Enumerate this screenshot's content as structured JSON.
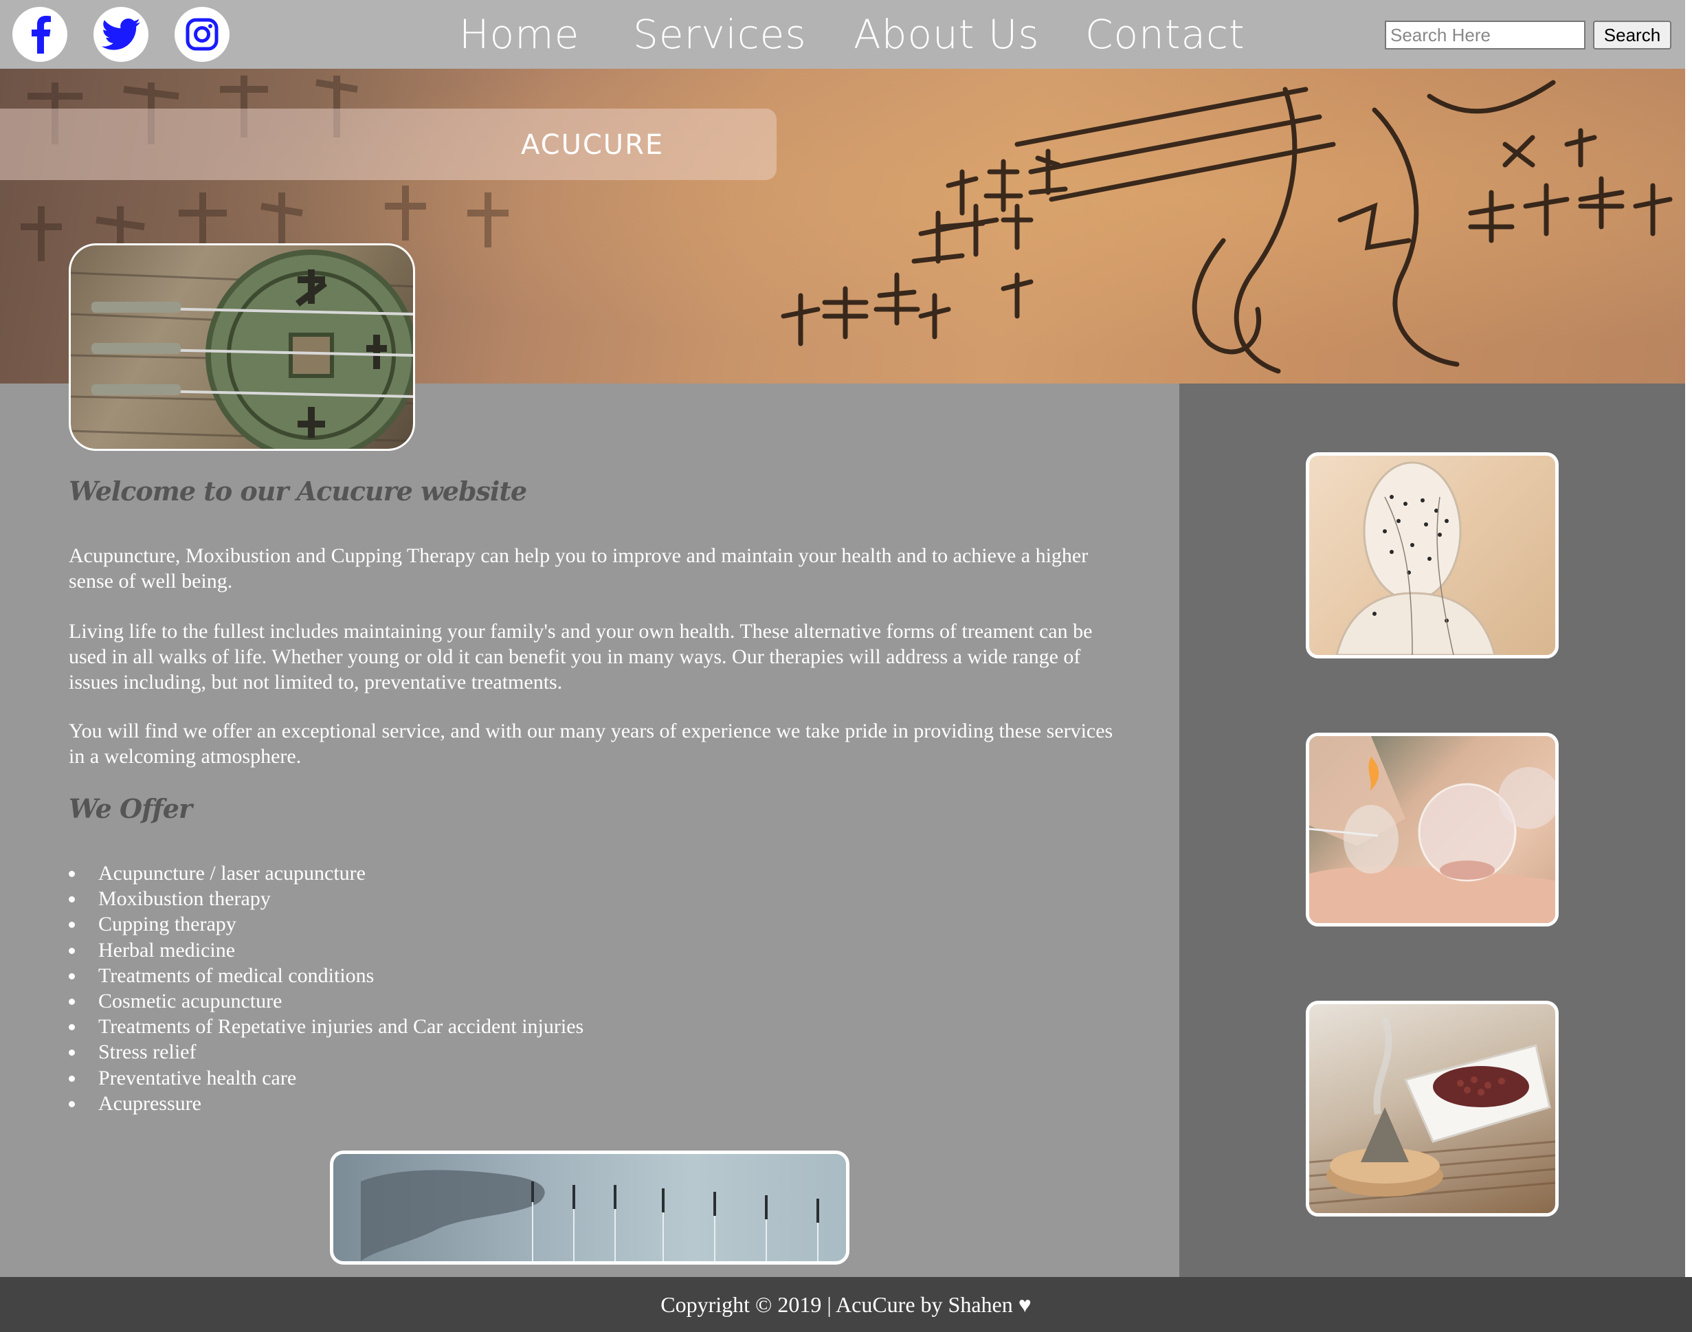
{
  "social": {
    "facebook_icon": "facebook-icon",
    "twitter_icon": "twitter-icon",
    "instagram_icon": "instagram-icon",
    "icon_color": "#1a1aff"
  },
  "nav": {
    "items": [
      {
        "label": "Home"
      },
      {
        "label": "Services"
      },
      {
        "label": "About Us"
      },
      {
        "label": "Contact"
      }
    ]
  },
  "search": {
    "placeholder": "Search Here",
    "value": "",
    "button_label": "Search"
  },
  "hero": {
    "title": "ACUCURE"
  },
  "main": {
    "welcome_heading": "Welcome to our Acucure website",
    "paragraphs": [
      "Acupuncture, Moxibustion and Cupping Therapy can help you to improve and maintain your health and to achieve a higher sense of well being.",
      "Living life to the fullest includes maintaining your family's and your own health. These alternative forms of treament can be used in all walks of life. Whether young or old it can benefit you in many ways. Our therapies will address a wide range of issues including, but not limited to, preventative treatments.",
      "You will find we offer an exceptional service, and with our many years of experience we take pride in providing these services in a welcoming atmosphere."
    ],
    "offer_heading": "We Offer",
    "offers": [
      "Acupuncture / laser acupuncture",
      "Moxibustion therapy",
      "Cupping therapy",
      "Herbal medicine",
      "Treatments of medical conditions",
      "Cosmetic acupuncture",
      "Treatments of Repetative injuries and Car accident injuries",
      "Stress relief",
      "Preventative health care",
      "Acupressure"
    ]
  },
  "footer": {
    "text": "Copyright © 2019 | AcuCure by Shahen ♥"
  },
  "colors": {
    "navbar_bg": "#b3b3b3",
    "main_bg": "#989898",
    "sidebar_bg": "#6e6e6e",
    "footer_bg": "#444444"
  }
}
